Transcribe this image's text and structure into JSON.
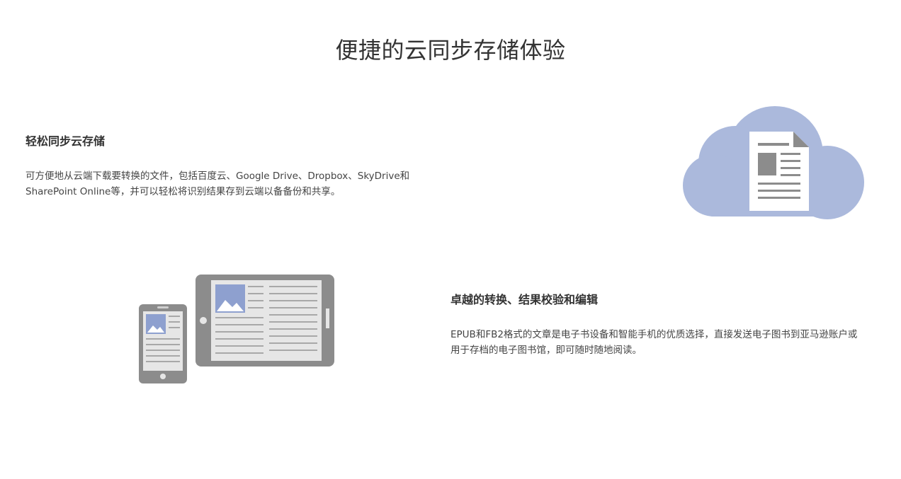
{
  "page": {
    "title": "便捷的云同步存储体验"
  },
  "features": [
    {
      "heading": "轻松同步云存储",
      "body_line1": "可方便地从云端下载要转换的文件，包括百度云、Google Drive、Dropbox、SkyDrive和",
      "body_line2": "SharePoint Online等，并可以轻松将识别结果存到云端以备备份和共享。",
      "illustration_icon": "cloud-document-icon"
    },
    {
      "heading": "卓越的转换、结果校验和编辑",
      "body_line1": "EPUB和FB2格式的文章是电子书设备和智能手机的优质选择，直接发送电子图书到亚马逊账户或",
      "body_line2": "用于存档的电子图书馆，即可随时随地阅读。",
      "illustration_icon": "phone-tablet-ebook-icon"
    }
  ],
  "colors": {
    "text": "#333333",
    "cloud": "#abb9dc",
    "device_frame": "#8c8c8c",
    "screen": "#e6e6e6",
    "image_blue": "#8ea0cf"
  }
}
